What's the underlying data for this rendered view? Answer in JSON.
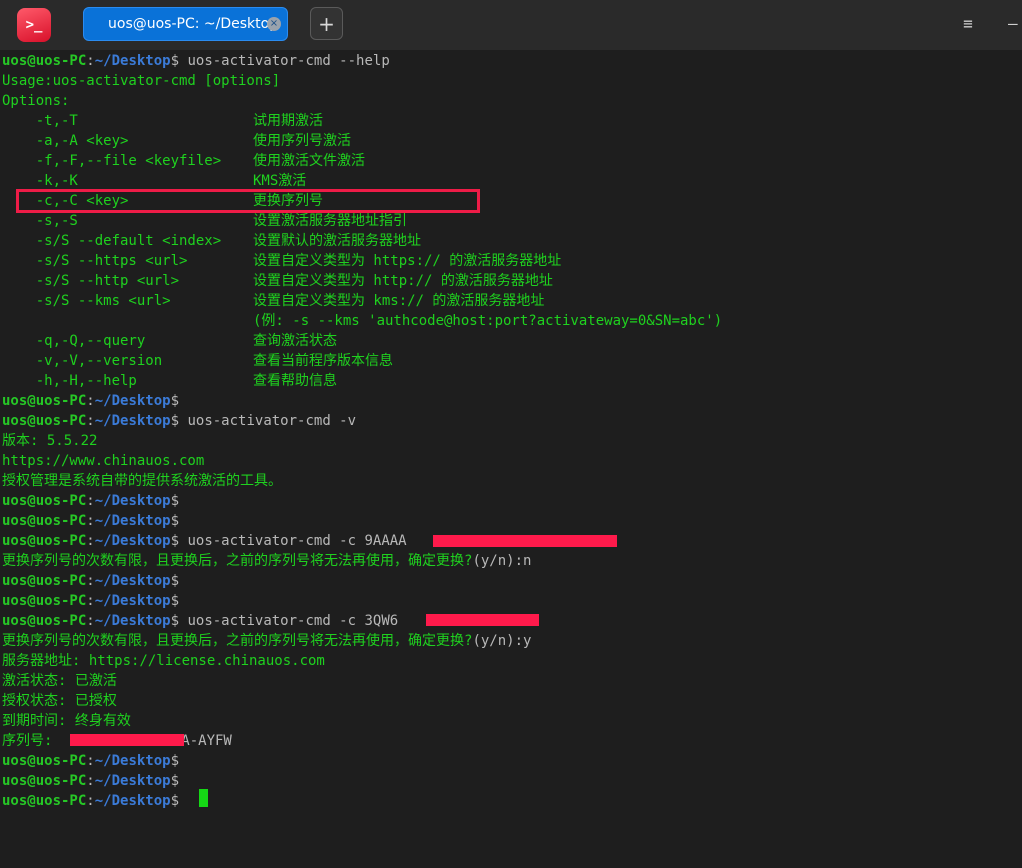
{
  "window": {
    "tab_title": "uos@uos-PC: ~/Desktop",
    "new_tab_label": "+",
    "menu_label": "≡",
    "app_icon": "terminal-icon"
  },
  "prompt": {
    "user": "uos@uos-PC",
    "colon": ":",
    "path": "~/Desktop",
    "dollar": "$"
  },
  "colors": {
    "green_text": "#1fd11f",
    "prompt_user": "#26c826",
    "prompt_path": "#3b7bd8",
    "redaction": "#ff1a4b",
    "highlight": "#ee1c47",
    "tab_active": "#0a72d8"
  },
  "help": {
    "command": " uos-activator-cmd --help",
    "usage": "Usage:uos-activator-cmd [options]",
    "options_header": "Options:",
    "options": [
      {
        "flag": "    -t,-T",
        "desc": "试用期激活"
      },
      {
        "flag": "    -a,-A <key>",
        "desc": "使用序列号激活"
      },
      {
        "flag": "    -f,-F,--file <keyfile>",
        "desc": "使用激活文件激活"
      },
      {
        "flag": "    -k,-K",
        "desc": "KMS激活"
      },
      {
        "flag": "    -c,-C <key>",
        "desc": "更换序列号"
      },
      {
        "flag": "    -s,-S",
        "desc": "设置激活服务器地址指引"
      },
      {
        "flag": "    -s/S --default <index>",
        "desc": "设置默认的激活服务器地址"
      },
      {
        "flag": "    -s/S --https <url>",
        "desc": "设置自定义类型为 https:// 的激活服务器地址"
      },
      {
        "flag": "    -s/S --http <url>",
        "desc": "设置自定义类型为 http:// 的激活服务器地址"
      },
      {
        "flag": "    -s/S --kms <url>",
        "desc": "设置自定义类型为 kms:// 的激活服务器地址"
      },
      {
        "flag": "",
        "desc": "(例: -s --kms 'authcode@host:port?activateway=0&SN=abc')"
      },
      {
        "flag": "    -q,-Q,--query",
        "desc": "查询激活状态"
      },
      {
        "flag": "    -v,-V,--version",
        "desc": "查看当前程序版本信息"
      },
      {
        "flag": "    -h,-H,--help",
        "desc": "查看帮助信息"
      }
    ]
  },
  "version": {
    "command": " uos-activator-cmd -v",
    "version_line": "版本: 5.5.22",
    "url_line": "https://www.chinauos.com",
    "desc_line": "授权管理是系统自带的提供系统激活的工具。"
  },
  "change1": {
    "command": " uos-activator-cmd -c 9AAAA",
    "prompt_text": "更换序列号的次数有限，且更换后，之前的序列号将无法再使用，确定更换?",
    "yn": "(y/n):n"
  },
  "change2": {
    "command": " uos-activator-cmd -c 3QW6",
    "prompt_text": "更换序列号的次数有限，且更换后，之前的序列号将无法再使用，确定更换?",
    "yn": "(y/n):y",
    "server_line": "服务器地址: https://license.chinauos.com",
    "status_line": "激活状态: 已激活",
    "auth_line": "授权状态: 已授权",
    "expiry_line": "到期时间: 终身有效",
    "serial_label": "序列号: ",
    "serial_tail": "AA-AYFW"
  }
}
